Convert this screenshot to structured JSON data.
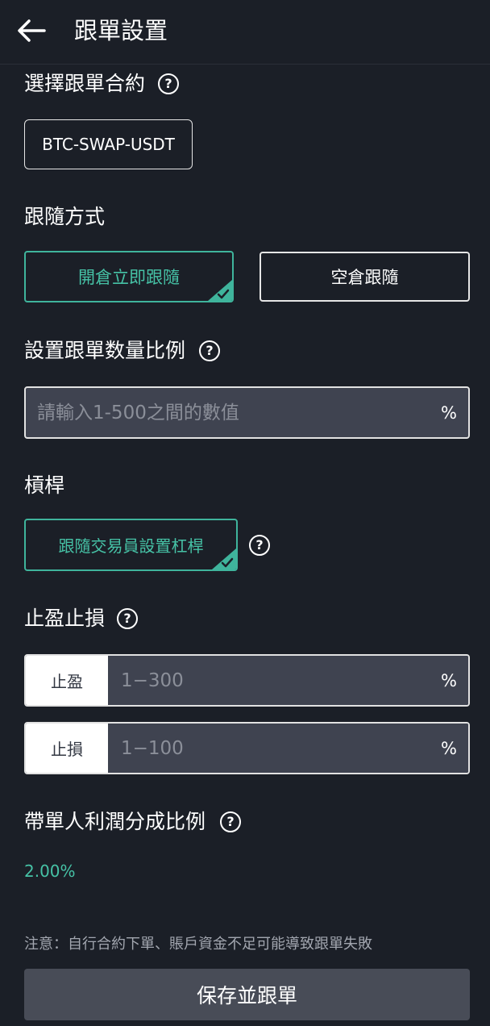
{
  "header": {
    "title": "跟單設置"
  },
  "contract": {
    "label": "選擇跟單合約",
    "selected": "BTC-SWAP-USDT"
  },
  "follow_mode": {
    "label": "跟隨方式",
    "options": [
      "開倉立即跟隨",
      "空倉跟隨"
    ],
    "selected_index": 0
  },
  "ratio": {
    "label": "設置跟單数量比例",
    "placeholder": "請輸入1-500之間的數值",
    "unit": "%"
  },
  "leverage": {
    "label": "槓桿",
    "option": "跟隨交易員設置杠桿"
  },
  "tpsl": {
    "label": "止盈止損",
    "take_profit": {
      "label": "止盈",
      "placeholder": "1−300",
      "unit": "%"
    },
    "stop_loss": {
      "label": "止損",
      "placeholder": "1−100",
      "unit": "%"
    }
  },
  "profit_share": {
    "label": "帶單人利潤分成比例",
    "value": "2.00%"
  },
  "note": "注意：自行合約下單、賬戶資金不足可能導致跟單失敗",
  "save_button": "保存並跟單",
  "colors": {
    "background": "#1b1f27",
    "accent": "#46c2a6",
    "input_bg": "#3f4350",
    "button_bg": "#484c57"
  },
  "icons": {
    "back": "arrow-left-icon",
    "help": "question-circle-icon",
    "check": "check-icon"
  }
}
